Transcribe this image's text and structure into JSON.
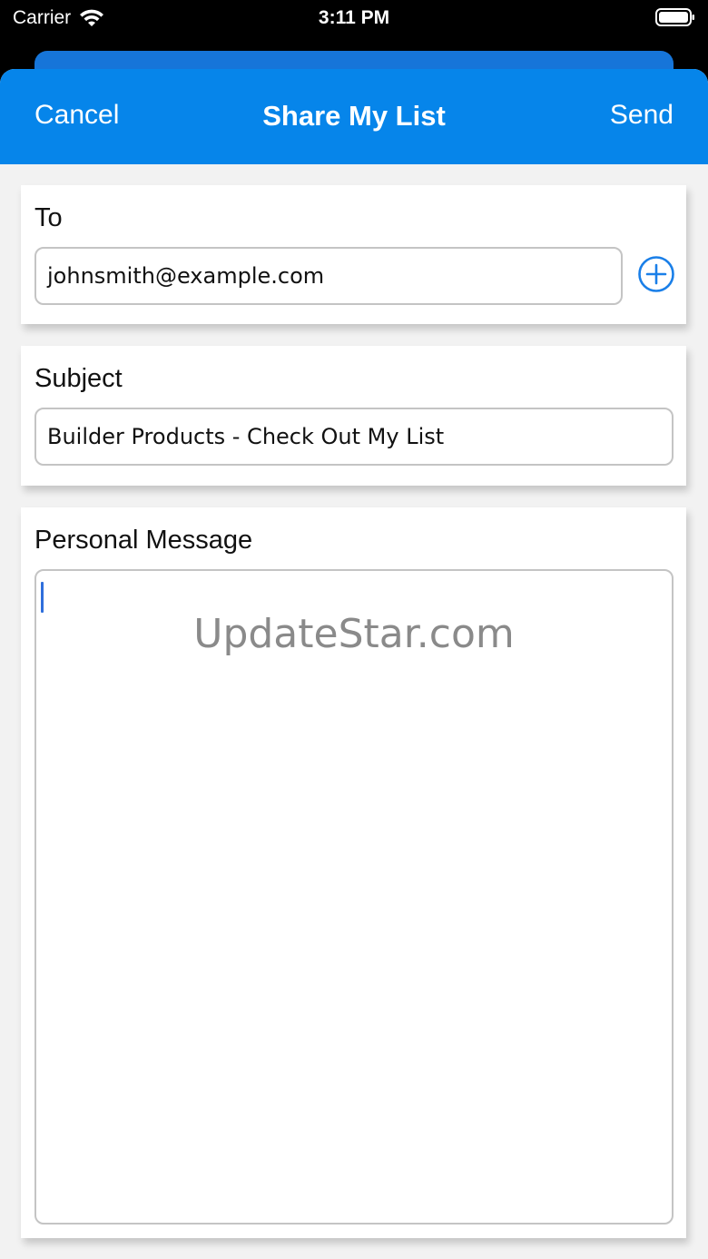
{
  "status_bar": {
    "carrier": "Carrier",
    "time": "3:11 PM",
    "wifi_icon": "wifi-icon",
    "battery_icon": "battery-icon"
  },
  "nav": {
    "cancel_label": "Cancel",
    "title": "Share My List",
    "send_label": "Send",
    "color": "#0685ea"
  },
  "to_section": {
    "label": "To",
    "email_value": "johnsmith@example.com",
    "add_icon": "plus-circle-icon"
  },
  "subject_section": {
    "label": "Subject",
    "value": "Builder Products - Check Out My List"
  },
  "message_section": {
    "label": "Personal Message",
    "value": ""
  },
  "watermark": "UpdateStar.com"
}
